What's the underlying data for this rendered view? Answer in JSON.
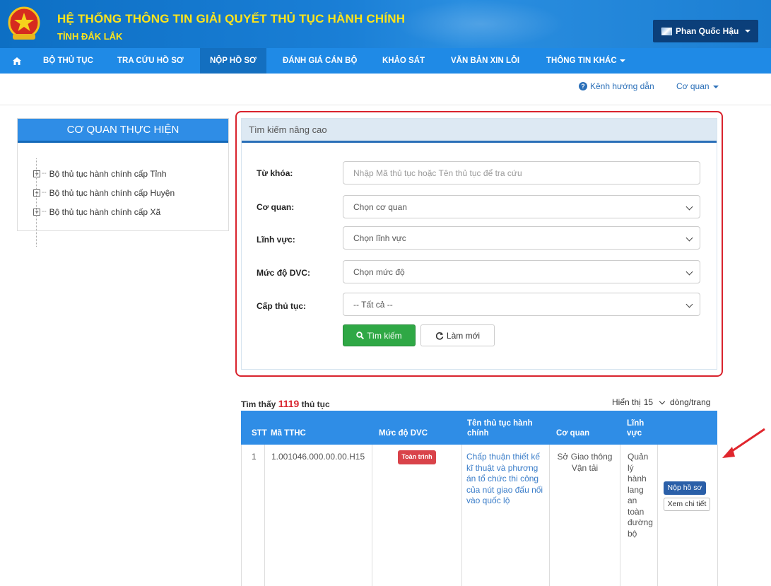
{
  "header": {
    "title": "HỆ THỐNG THÔNG TIN GIẢI QUYẾT THỦ TỤC HÀNH CHÍNH",
    "subtitle": "TỈNH ĐẮK LẮK",
    "user": "Phan Quốc Hậu",
    "logo_icon": "national-emblem-icon"
  },
  "nav": {
    "items": [
      {
        "label": "BỘ THỦ TỤC"
      },
      {
        "label": "TRA CỨU HỒ SƠ"
      },
      {
        "label": "NỘP HỒ SƠ"
      },
      {
        "label": "ĐÁNH GIÁ CÁN BỘ"
      },
      {
        "label": "KHẢO SÁT"
      },
      {
        "label": "VĂN BẢN XIN LỖI"
      },
      {
        "label": "THÔNG TIN KHÁC"
      }
    ],
    "active": "NỘP HỒ SƠ"
  },
  "util": {
    "help": "Kênh hướng dẫn",
    "org": "Cơ quan"
  },
  "left_panel": {
    "title": "CƠ QUAN THỰC HIỆN",
    "items": [
      {
        "label": "Bộ thủ tục hành chính cấp Tỉnh"
      },
      {
        "label": "Bộ thủ tục hành chính cấp Huyện"
      },
      {
        "label": "Bộ thủ tục hành chính cấp Xã"
      }
    ]
  },
  "search": {
    "title": "Tìm kiếm nâng cao",
    "keyword_label": "Từ khóa:",
    "keyword_placeholder": "Nhập Mã thủ tục hoặc Tên thủ tục để tra cứu",
    "org_label": "Cơ quan:",
    "org_value": "Chọn cơ quan",
    "field_label": "Lĩnh vực:",
    "field_value": "Chọn lĩnh vực",
    "level_label": "Mức độ DVC:",
    "level_value": "Chọn mức độ",
    "tier_label": "Cấp thủ tục:",
    "tier_value": "-- Tất cả --",
    "search_button": "Tìm kiếm",
    "reset_button": "Làm mới"
  },
  "results": {
    "found_prefix": "Tìm thấy",
    "count": "1119",
    "found_suffix": "thủ tục",
    "perpage_prefix": "Hiển thị",
    "perpage_value": "15",
    "perpage_suffix": "dòng/trang",
    "columns": [
      "STT",
      "Mã TTHC",
      "Mức độ DVC",
      "Tên thủ tục hành chính",
      "Cơ quan",
      "Lĩnh vực"
    ],
    "rows": [
      {
        "stt": "1",
        "code": "1.001046.000.00.00.H15",
        "level": "Toàn trình",
        "name": "Chấp thuận thiết kế kĩ thuật và phương án tổ chức thi công của nút giao đấu nối vào quốc lộ",
        "org": "Sở Giao thông Vận tải",
        "field": "Quản lý hành lang an toàn đường bộ",
        "submit": "Nộp hồ sơ",
        "detail": "Xem chi tiết"
      }
    ]
  },
  "colors": {
    "header_blue": "#1a7fd6",
    "nav_blue": "#1f8ae6",
    "title_yellow": "#ffe41a",
    "highlight_red": "#d9232d",
    "search_green": "#2fa845"
  }
}
